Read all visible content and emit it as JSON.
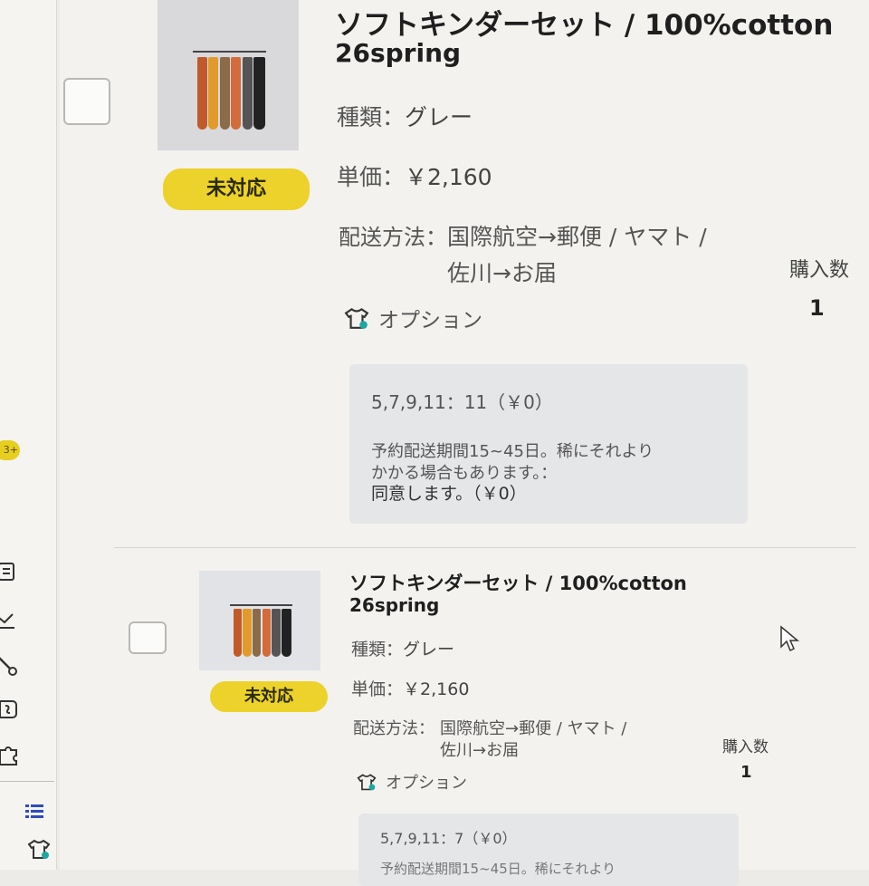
{
  "sidebar": {
    "badge": "3+",
    "icons": [
      "document-icon",
      "check-icon",
      "brush-icon",
      "coupon-icon",
      "puzzle-icon",
      "list-icon",
      "tshirt-icon"
    ]
  },
  "orders": [
    {
      "title_line1": "ソフトキンダーセット / 100%cotton",
      "title_line2": "26spring",
      "status": "未対応",
      "kind_label": "種類：",
      "kind_value": "グレー",
      "price_label": "単価：",
      "price_value": "￥2,160",
      "shipping_label": "配送方法：",
      "shipping_line1": "国際航空→郵便 / ヤマト /",
      "shipping_line2": "佐川→お届",
      "option_label": "オプション",
      "qty_label": "購入数",
      "qty_value": "1",
      "option_lines": [
        "5,7,9,11：11（￥0）",
        "予約配送期間15~45日。稀にそれより",
        "かかる場合もあります。：",
        "同意します。（￥0）"
      ]
    },
    {
      "title_line1": "ソフトキンダーセット / 100%cotton",
      "title_line2": "26spring",
      "status": "未対応",
      "kind_label": "種類：",
      "kind_value": "グレー",
      "price_label": "単価：",
      "price_value": "￥2,160",
      "shipping_label": "配送方法：",
      "shipping_line1": "国際航空→郵便 / ヤマト /",
      "shipping_line2": "佐川→お届",
      "option_label": "オプション",
      "qty_label": "購入数",
      "qty_value": "1",
      "option_lines": [
        "5,7,9,11：7（￥0）",
        "予約配送期間15~45日。稀にそれより"
      ]
    }
  ],
  "colors": {
    "status_badge": "#ecd22a",
    "background": "#f3f2ef"
  }
}
